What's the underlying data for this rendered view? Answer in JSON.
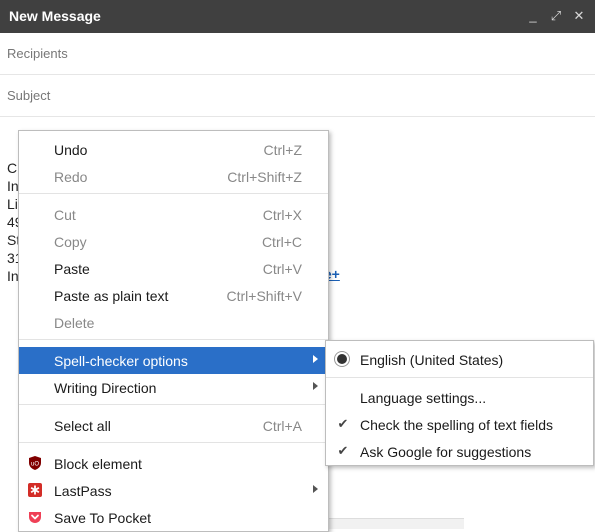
{
  "window": {
    "title": "New Message",
    "controls": {
      "minimize": "_",
      "maximize": "⤢",
      "close": "✕"
    }
  },
  "compose": {
    "recipients_placeholder": "Recipients",
    "subject_placeholder": "Subject",
    "body_fragments": [
      "C",
      "In",
      "Li",
      "49",
      "St",
      "31",
      "In"
    ],
    "link_fragment": "le+"
  },
  "context_menu": {
    "items": [
      {
        "label": "Undo",
        "shortcut": "Ctrl+Z",
        "enabled": true
      },
      {
        "label": "Redo",
        "shortcut": "Ctrl+Shift+Z",
        "enabled": false
      },
      {
        "label": "Cut",
        "shortcut": "Ctrl+X",
        "enabled": false
      },
      {
        "label": "Copy",
        "shortcut": "Ctrl+C",
        "enabled": false
      },
      {
        "label": "Paste",
        "shortcut": "Ctrl+V",
        "enabled": true
      },
      {
        "label": "Paste as plain text",
        "shortcut": "Ctrl+Shift+V",
        "enabled": true
      },
      {
        "label": "Delete",
        "shortcut": "",
        "enabled": false
      },
      {
        "label": "Spell-checker options",
        "shortcut": "",
        "enabled": true,
        "submenu": true,
        "highlighted": true
      },
      {
        "label": "Writing Direction",
        "shortcut": "",
        "enabled": true,
        "submenu": true
      },
      {
        "label": "Select all",
        "shortcut": "Ctrl+A",
        "enabled": true
      },
      {
        "label": "Block element",
        "icon": "ublock-shield-icon",
        "enabled": true
      },
      {
        "label": "LastPass",
        "icon": "lastpass-icon",
        "enabled": true,
        "submenu": true
      },
      {
        "label": "Save To Pocket",
        "icon": "pocket-icon",
        "enabled": true
      }
    ]
  },
  "spellcheck_submenu": {
    "items": [
      {
        "label": "English (United States)",
        "mark": "radio-selected"
      },
      {
        "label": "Language settings...",
        "mark": ""
      },
      {
        "label": "Check the spelling of text fields",
        "mark": "check"
      },
      {
        "label": "Ask Google for suggestions",
        "mark": "check"
      }
    ]
  },
  "colors": {
    "highlight": "#2a6fc8",
    "titlebar": "#404040",
    "ublock": "#800000",
    "lastpass": "#d32d27",
    "pocket": "#ef4056"
  }
}
